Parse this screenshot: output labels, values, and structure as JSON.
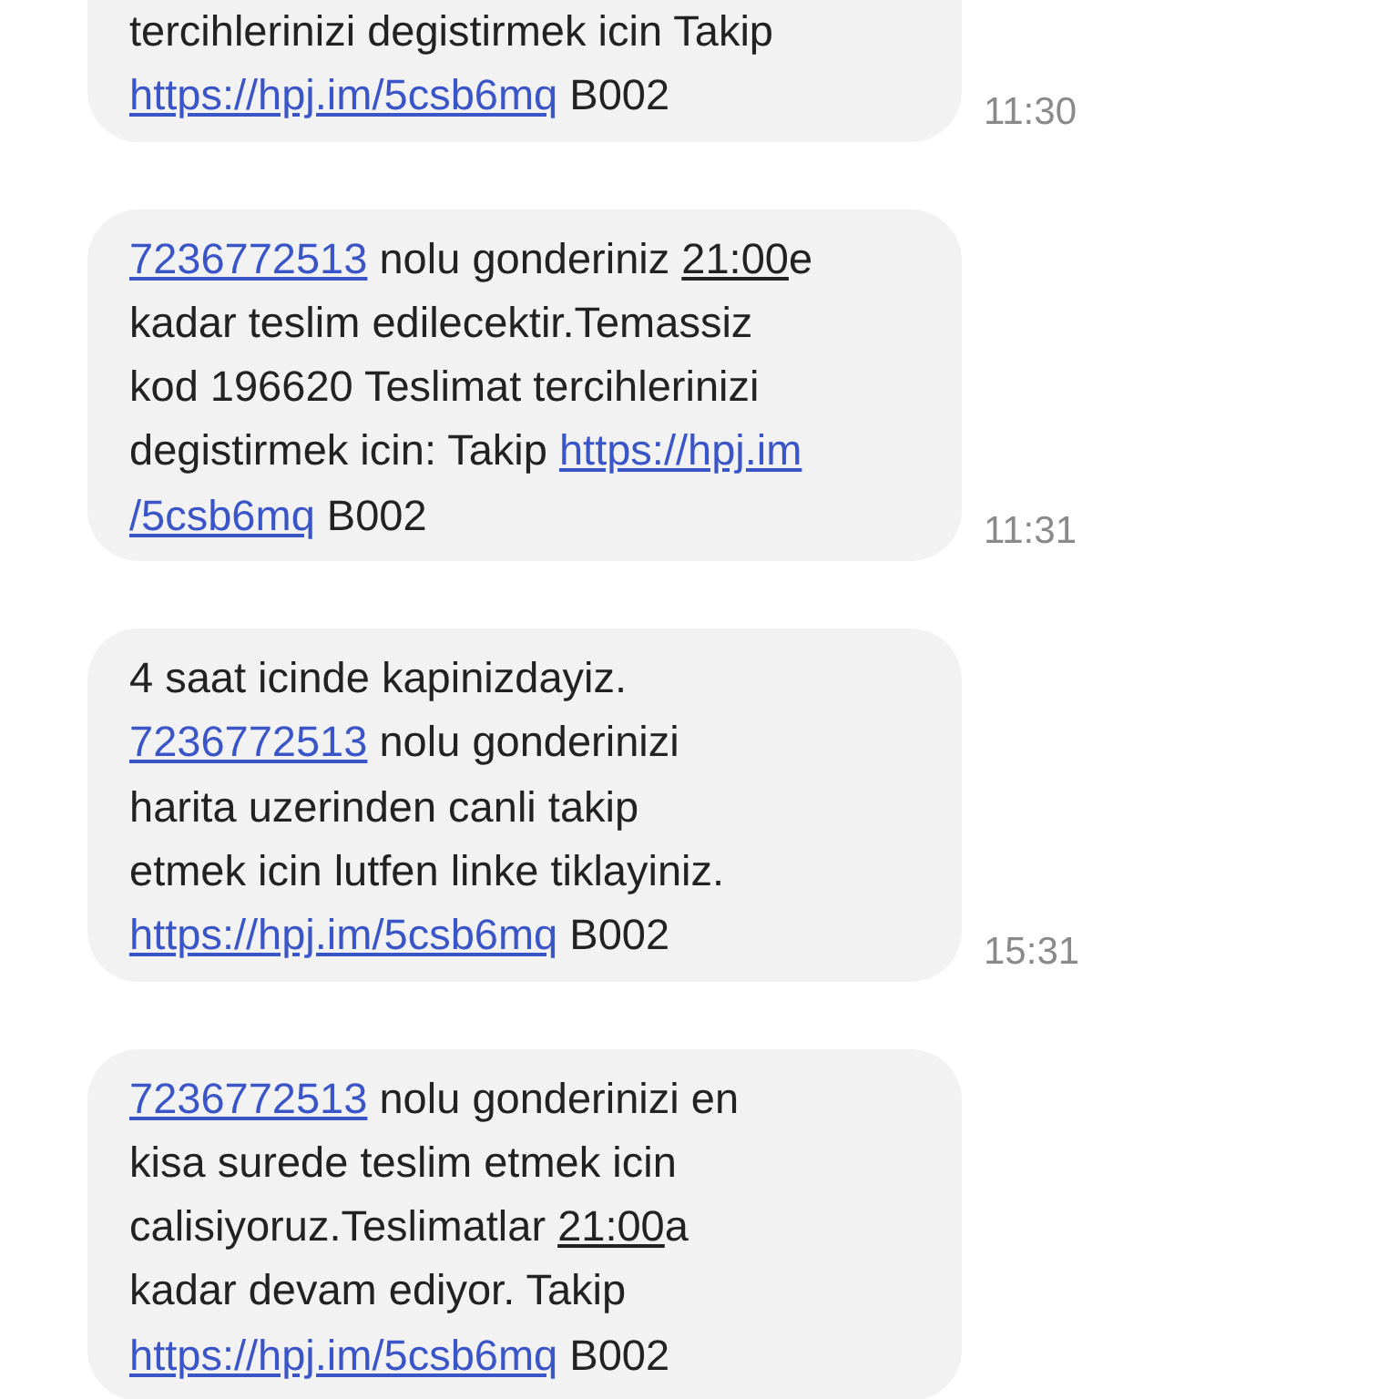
{
  "messages": [
    {
      "time": "11:30",
      "lines": [
        [
          {
            "kind": "text",
            "text": "tercihlerinizi degistirmek icin Takip"
          }
        ],
        [
          {
            "kind": "link",
            "text": "https://hpj.im/5csb6mq"
          },
          {
            "kind": "text",
            "text": " B002"
          }
        ]
      ]
    },
    {
      "time": "11:31",
      "lines": [
        [
          {
            "kind": "link",
            "text": "7236772513"
          },
          {
            "kind": "text",
            "text": " nolu gonderiniz "
          },
          {
            "kind": "time",
            "text": "21:00"
          },
          {
            "kind": "text",
            "text": "e"
          }
        ],
        [
          {
            "kind": "text",
            "text": "kadar teslim edilecektir.Temassiz"
          }
        ],
        [
          {
            "kind": "text",
            "text": "kod 196620 Teslimat tercihlerinizi"
          }
        ],
        [
          {
            "kind": "text",
            "text": "degistirmek icin: Takip "
          },
          {
            "kind": "link",
            "text": "https://hpj.im"
          }
        ],
        [
          {
            "kind": "link",
            "text": "/5csb6mq"
          },
          {
            "kind": "text",
            "text": " B002"
          }
        ]
      ]
    },
    {
      "time": "15:31",
      "lines": [
        [
          {
            "kind": "text",
            "text": "4 saat icinde kapinizdayiz."
          }
        ],
        [
          {
            "kind": "link",
            "text": "7236772513"
          },
          {
            "kind": "text",
            "text": " nolu gonderinizi"
          }
        ],
        [
          {
            "kind": "text",
            "text": "harita uzerinden canli takip"
          }
        ],
        [
          {
            "kind": "text",
            "text": "etmek icin lutfen linke tiklayiniz."
          }
        ],
        [
          {
            "kind": "link",
            "text": "https://hpj.im/5csb6mq"
          },
          {
            "kind": "text",
            "text": " B002"
          }
        ]
      ]
    },
    {
      "lines": [
        [
          {
            "kind": "link",
            "text": "7236772513"
          },
          {
            "kind": "text",
            "text": " nolu gonderinizi en"
          }
        ],
        [
          {
            "kind": "text",
            "text": "kisa surede teslim etmek icin"
          }
        ],
        [
          {
            "kind": "text",
            "text": "calisiyoruz.Teslimatlar "
          },
          {
            "kind": "time",
            "text": "21:00"
          },
          {
            "kind": "text",
            "text": "a"
          }
        ],
        [
          {
            "kind": "text",
            "text": "kadar devam ediyor. Takip"
          }
        ],
        [
          {
            "kind": "link",
            "text": "https://hpj.im/5csb6mq"
          },
          {
            "kind": "text",
            "text": " B002"
          }
        ]
      ]
    }
  ]
}
